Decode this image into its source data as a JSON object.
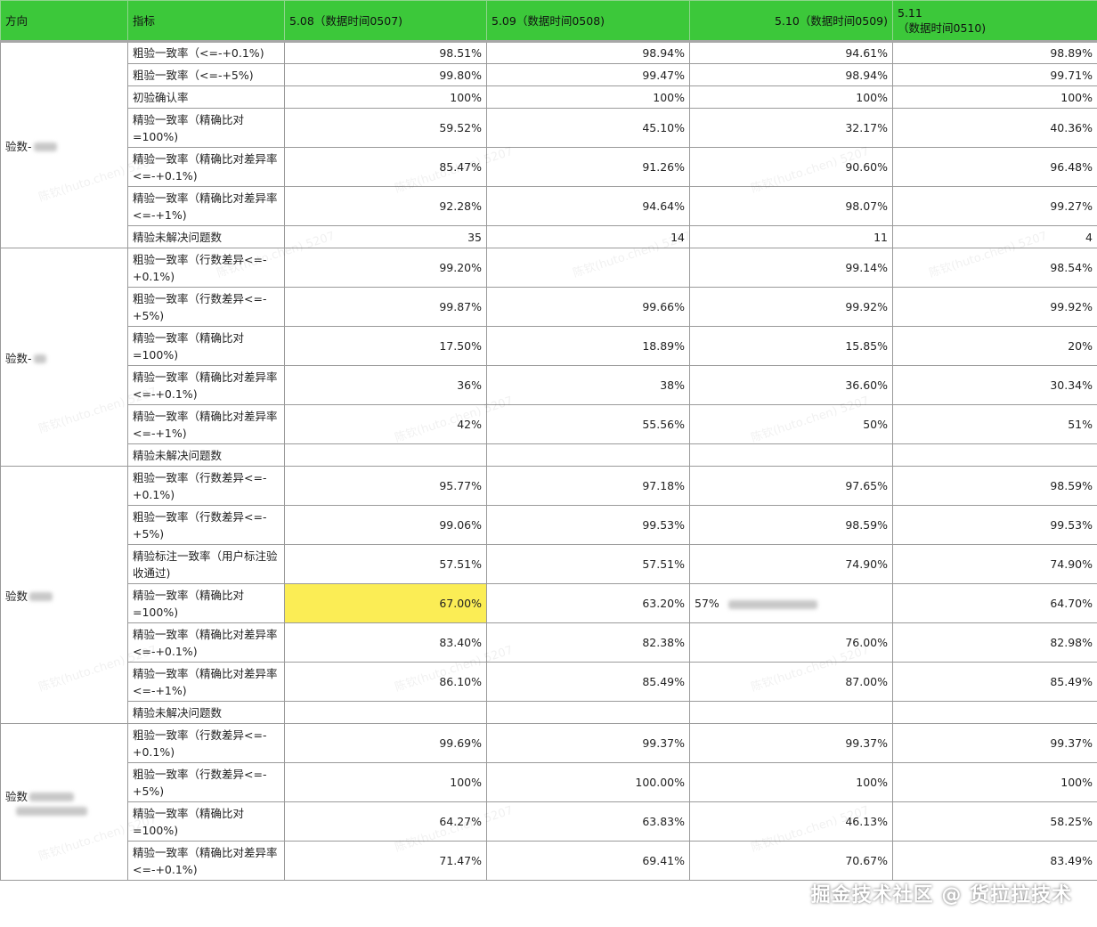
{
  "header": {
    "col_direction": "方向",
    "col_metric": "指标",
    "col_d1": "5.08（数据时间0507)",
    "col_d2": "5.09（数据时间0508)",
    "col_d3": "5.10（数据时间0509)",
    "col_d4_line1": "5.11",
    "col_d4_line2": "（数据时间0510)"
  },
  "groups": [
    {
      "direction": "验数-",
      "rows": [
        {
          "metric": "粗验一致率（<=-+0.1%)",
          "values": [
            "98.51%",
            "98.94%",
            "94.61%",
            "98.89%"
          ]
        },
        {
          "metric": "粗验一致率（<=-+5%)",
          "values": [
            "99.80%",
            "99.47%",
            "98.94%",
            "99.71%"
          ]
        },
        {
          "metric": "初验确认率",
          "values": [
            "100%",
            "100%",
            "100%",
            "100%"
          ]
        },
        {
          "metric": "精验一致率（精确比对=100%)",
          "values": [
            "59.52%",
            "45.10%",
            "32.17%",
            "40.36%"
          ]
        },
        {
          "metric": "精验一致率（精确比对差异率<=-+0.1%)",
          "values": [
            "85.47%",
            "91.26%",
            "90.60%",
            "96.48%"
          ]
        },
        {
          "metric": "精验一致率（精确比对差异率<=-+1%)",
          "values": [
            "92.28%",
            "94.64%",
            "98.07%",
            "99.27%"
          ]
        },
        {
          "metric": "精验未解决问题数",
          "values": [
            "35",
            "14",
            "11",
            "4"
          ]
        }
      ]
    },
    {
      "direction": "验数-",
      "rows": [
        {
          "metric": "粗验一致率（行数差异<=-+0.1%)",
          "values": [
            "99.20%",
            "",
            "99.14%",
            "98.54%"
          ]
        },
        {
          "metric": "粗验一致率（行数差异<=-+5%)",
          "values": [
            "99.87%",
            "99.66%",
            "99.92%",
            "99.92%"
          ]
        },
        {
          "metric": "精验一致率（精确比对=100%)",
          "values": [
            "17.50%",
            "18.89%",
            "15.85%",
            "20%"
          ]
        },
        {
          "metric": "精验一致率（精确比对差异率<=-+0.1%)",
          "values": [
            "36%",
            "38%",
            "36.60%",
            "30.34%"
          ]
        },
        {
          "metric": "精验一致率（精确比对差异率<=-+1%)",
          "values": [
            "42%",
            "55.56%",
            "50%",
            "51%"
          ]
        },
        {
          "metric": "精验未解决问题数",
          "values": [
            "",
            "",
            "",
            ""
          ]
        }
      ]
    },
    {
      "direction": "验数",
      "rows": [
        {
          "metric": "粗验一致率（行数差异<=-+0.1%)",
          "values": [
            "95.77%",
            "97.18%",
            "97.65%",
            "98.59%"
          ]
        },
        {
          "metric": "粗验一致率（行数差异<=-+5%)",
          "values": [
            "99.06%",
            "99.53%",
            "98.59%",
            "99.53%"
          ]
        },
        {
          "metric": "精验标注一致率（用户标注验收通过)",
          "values": [
            "57.51%",
            "57.51%",
            "74.90%",
            "74.90%"
          ]
        },
        {
          "metric": "精验一致率（精确比对=100%)",
          "values": [
            "67.00%",
            "63.20%",
            "57%",
            "64.70%"
          ]
        },
        {
          "metric": "精验一致率（精确比对差异率<=-+0.1%)",
          "values": [
            "83.40%",
            "82.38%",
            "76.00%",
            "82.98%"
          ]
        },
        {
          "metric": "精验一致率（精确比对差异率<=-+1%)",
          "values": [
            "86.10%",
            "85.49%",
            "87.00%",
            "85.49%"
          ]
        },
        {
          "metric": "精验未解决问题数",
          "values": [
            "",
            "",
            "",
            ""
          ]
        }
      ]
    },
    {
      "direction": "验数",
      "rows": [
        {
          "metric": "粗验一致率（行数差异<=-+0.1%)",
          "values": [
            "99.69%",
            "99.37%",
            "99.37%",
            "99.37%"
          ]
        },
        {
          "metric": "粗验一致率（行数差异<=-+5%)",
          "values": [
            "100%",
            "100.00%",
            "100%",
            "100%"
          ]
        },
        {
          "metric": "精验一致率（精确比对=100%)",
          "values": [
            "64.27%",
            "63.83%",
            "46.13%",
            "58.25%"
          ]
        },
        {
          "metric": "精验一致率（精确比对差异率<=-+0.1%)",
          "values": [
            "71.47%",
            "69.41%",
            "70.67%",
            "83.49%"
          ]
        }
      ]
    }
  ],
  "highlight_color": "#fbed55",
  "header_color": "#3cc83a",
  "watermark": "陈钦(huto.chen) 5207",
  "brand": "掘金技术社区 @ 货拉拉技术"
}
